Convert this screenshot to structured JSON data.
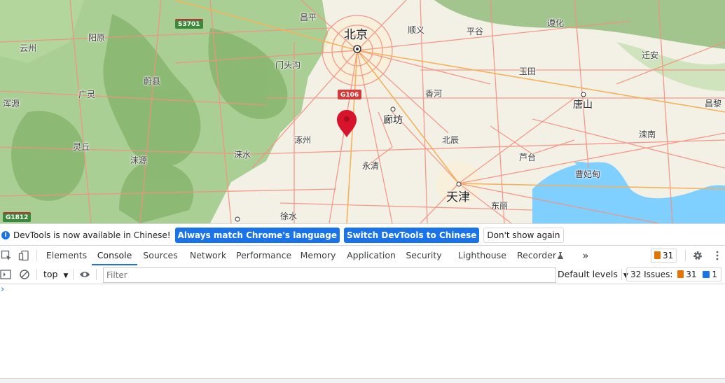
{
  "map": {
    "colors": {
      "water": "#7fcfff",
      "land": "#f3f1e6",
      "terrain": "#8bbf73",
      "road": "#f59080",
      "highway": "#f4b25a",
      "marker": "#d7142b"
    },
    "cities": [
      {
        "name": "昌平",
        "key": "changping"
      },
      {
        "name": "北京",
        "key": "beijing"
      },
      {
        "name": "顺义",
        "key": "shunyi"
      },
      {
        "name": "平谷",
        "key": "pinggu"
      },
      {
        "name": "遵化",
        "key": "zunhua"
      },
      {
        "name": "阳原",
        "key": "yangyuan"
      },
      {
        "name": "云州",
        "key": "yunzhou"
      },
      {
        "name": "门头沟",
        "key": "mentougou"
      },
      {
        "name": "迁安",
        "key": "qianan"
      },
      {
        "name": "蔚县",
        "key": "yuxian"
      },
      {
        "name": "玉田",
        "key": "yutian"
      },
      {
        "name": "广灵",
        "key": "guangling"
      },
      {
        "name": "香河",
        "key": "xianghe"
      },
      {
        "name": "浑源",
        "key": "hunyuan"
      },
      {
        "name": "廊坊",
        "key": "langfang"
      },
      {
        "name": "唐山",
        "key": "tangshan"
      },
      {
        "name": "昌黎",
        "key": "changli"
      },
      {
        "name": "涿州",
        "key": "zhuozhou"
      },
      {
        "name": "北辰",
        "key": "beichen"
      },
      {
        "name": "滦南",
        "key": "luannan"
      },
      {
        "name": "灵丘",
        "key": "lingqiu"
      },
      {
        "name": "涞水",
        "key": "laishui"
      },
      {
        "name": "涞源",
        "key": "laiyuan"
      },
      {
        "name": "芦台",
        "key": "lutai"
      },
      {
        "name": "永清",
        "key": "yongqing"
      },
      {
        "name": "曹妃甸",
        "key": "caofeidian"
      },
      {
        "name": "天津",
        "key": "tianjin"
      },
      {
        "name": "徐水",
        "key": "xushui"
      },
      {
        "name": "东丽",
        "key": "dongli"
      }
    ],
    "shields": {
      "s3701": "S3701",
      "g106": "G106",
      "g1812": "G1812"
    }
  },
  "infobar": {
    "message": "DevTools is now available in Chinese!",
    "btn_match": "Always match Chrome's language",
    "btn_switch": "Switch DevTools to Chinese",
    "btn_dont": "Don't show again"
  },
  "tabs": [
    "Elements",
    "Console",
    "Sources",
    "Network",
    "Performance",
    "Memory",
    "Application",
    "Security",
    "Lighthouse",
    "Recorder"
  ],
  "tabbar": {
    "issues_count": "31",
    "more": "»"
  },
  "console_toolbar": {
    "context": "top",
    "filter_placeholder": "Filter",
    "levels": "Default levels",
    "issues_label": "32 Issues:",
    "issues_warn": "31",
    "issues_info": "1"
  },
  "console": {
    "prompt": "›"
  }
}
